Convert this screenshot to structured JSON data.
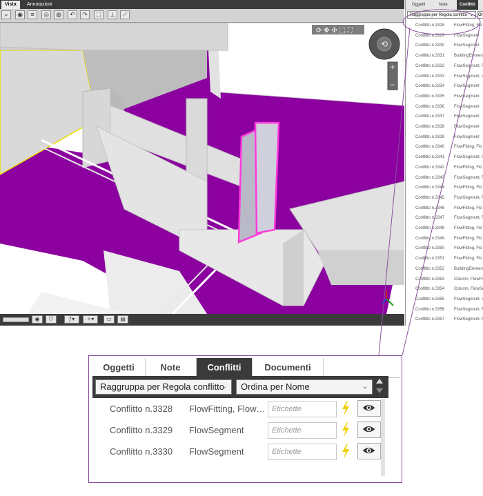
{
  "viewer": {
    "tabs": [
      "Vista",
      "Annotazioni"
    ],
    "active_tab": "Vista",
    "colors": {
      "floor": "#8b009f",
      "highlight": "#ff3bdc",
      "selection": "#e8e000",
      "duct": "#d9d9d9"
    }
  },
  "right_panel": {
    "tabs": [
      "Oggetti",
      "Note",
      "Conflitti"
    ],
    "active_tab": "Conflitti",
    "group_by": "Raggruppa per Regola conflitto",
    "sort_by": "Or",
    "rows": [
      {
        "name": "Conflitto n.3328",
        "type": "FlowFitting, Flo"
      },
      {
        "name": "Conflitto n.3329",
        "type": "FlowSegment"
      },
      {
        "name": "Conflitto n.3330",
        "type": "FlowSegment"
      },
      {
        "name": "Conflitto n.3331",
        "type": "BuildingElement"
      },
      {
        "name": "Conflitto n.3332",
        "type": "FlowSegment, F"
      },
      {
        "name": "Conflitto n.3333",
        "type": "FlowSegment, V"
      },
      {
        "name": "Conflitto n.3334",
        "type": "FlowSegment"
      },
      {
        "name": "Conflitto n.3335",
        "type": "FlowSegment"
      },
      {
        "name": "Conflitto n.3336",
        "type": "FlowSegment"
      },
      {
        "name": "Conflitto n.3337",
        "type": "FlowSegment"
      },
      {
        "name": "Conflitto n.3338",
        "type": "FlowSegment"
      },
      {
        "name": "Conflitto n.3339",
        "type": "FlowSegment"
      },
      {
        "name": "Conflitto n.3340",
        "type": "FlowFitting, Flo"
      },
      {
        "name": "Conflitto n.3341",
        "type": "FlowSegment, F"
      },
      {
        "name": "Conflitto n.3342",
        "type": "FlowFitting, Flo"
      },
      {
        "name": "Conflitto n.3343",
        "type": "FlowSegment, F"
      },
      {
        "name": "Conflitto n.3344",
        "type": "FlowFitting, Flo"
      },
      {
        "name": "Conflitto n.3345",
        "type": "FlowSegment, F"
      },
      {
        "name": "Conflitto n.3346",
        "type": "FlowFitting, Flo"
      },
      {
        "name": "Conflitto n.3347",
        "type": "FlowSegment, F"
      },
      {
        "name": "Conflitto n.3348",
        "type": "FlowFitting, Flo"
      },
      {
        "name": "Conflitto n.3349",
        "type": "FlowFitting, Flo"
      },
      {
        "name": "Conflitto n.3350",
        "type": "FlowFitting, Flo"
      },
      {
        "name": "Conflitto n.3351",
        "type": "FlowFitting, Flo"
      },
      {
        "name": "Conflitto n.3352",
        "type": "BuildingElement"
      },
      {
        "name": "Conflitto n.3353",
        "type": "Column, FlowFitt"
      },
      {
        "name": "Conflitto n.3354",
        "type": "Column, FlowSe"
      },
      {
        "name": "Conflitto n.3355",
        "type": "FlowSegment, V"
      },
      {
        "name": "Conflitto n.3356",
        "type": "FlowSegment, F"
      },
      {
        "name": "Conflitto n.3357",
        "type": "FlowSegment, F"
      }
    ]
  },
  "callout": {
    "tabs": [
      "Oggetti",
      "Note",
      "Conflitti",
      "Documenti"
    ],
    "active_tab": "Conflitti",
    "group_by": "Raggruppa per Regola conflitto",
    "sort_by": "Ordina per Nome",
    "tag_placeholder": "Etichette",
    "rows": [
      {
        "name": "Conflitto n.3328",
        "type": "FlowFitting, FlowS..."
      },
      {
        "name": "Conflitto n.3329",
        "type": "FlowSegment"
      },
      {
        "name": "Conflitto n.3330",
        "type": "FlowSegment"
      }
    ],
    "icons": {
      "bolt": "lightning-icon",
      "eye": "eye-icon"
    },
    "colors": {
      "frame": "#8a4f9e",
      "bolt": "#f0d000"
    }
  }
}
